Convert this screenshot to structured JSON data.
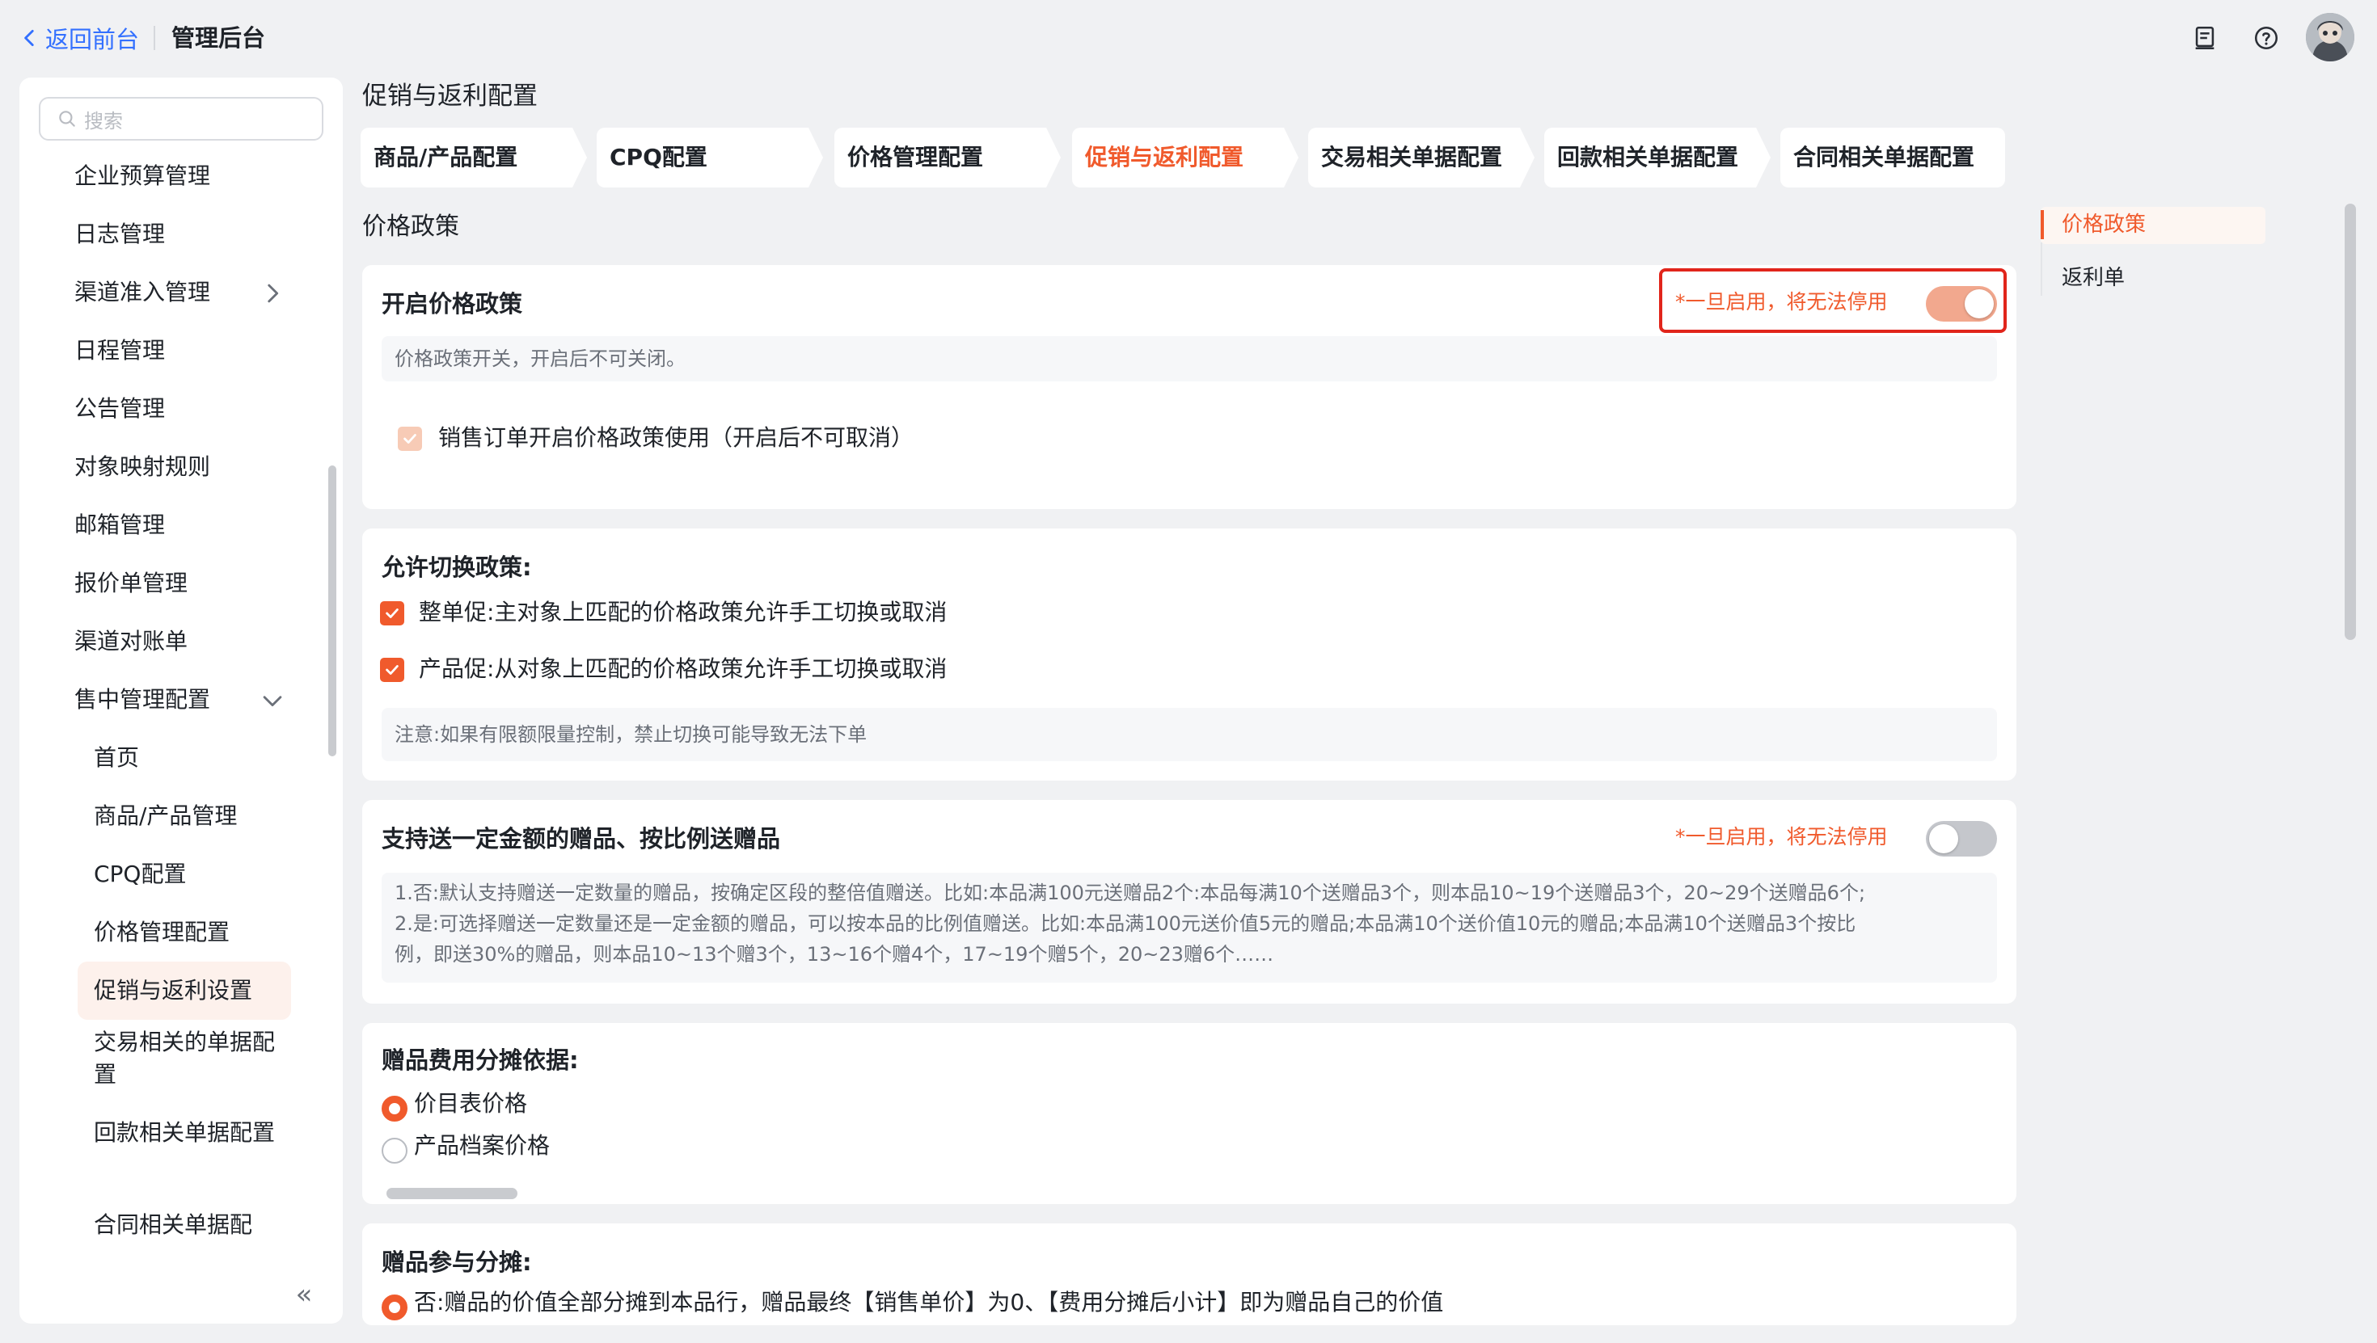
{
  "header": {
    "back_label": "返回前台",
    "app_title": "管理后台",
    "icons": [
      "document-icon",
      "help-icon",
      "avatar"
    ]
  },
  "sidebar": {
    "search_placeholder": "搜索",
    "items": [
      {
        "label": "企业预算管理"
      },
      {
        "label": "日志管理"
      },
      {
        "label": "渠道准入管理",
        "expandable": true,
        "expanded": false
      },
      {
        "label": "日程管理"
      },
      {
        "label": "公告管理"
      },
      {
        "label": "对象映射规则"
      },
      {
        "label": "邮箱管理"
      },
      {
        "label": "报价单管理"
      },
      {
        "label": "渠道对账单"
      },
      {
        "label": "售中管理配置",
        "expandable": true,
        "expanded": true
      }
    ],
    "sub_items": [
      {
        "label": "首页"
      },
      {
        "label": "商品/产品管理"
      },
      {
        "label": "CPQ配置"
      },
      {
        "label": "价格管理配置"
      },
      {
        "label": "促销与返利设置",
        "active": true
      },
      {
        "label": "交易相关的单据配置"
      },
      {
        "label": "回款相关单据配置"
      },
      {
        "label": "合同相关单据配"
      }
    ],
    "collapse_glyph": "«"
  },
  "main": {
    "page_title": "促销与返利配置",
    "tabs": [
      {
        "label": "商品/产品配置"
      },
      {
        "label": "CPQ配置"
      },
      {
        "label": "价格管理配置"
      },
      {
        "label": "促销与返利配置",
        "active": true
      },
      {
        "label": "交易相关单据配置"
      },
      {
        "label": "回款相关单据配置"
      },
      {
        "label": "合同相关单据配置"
      }
    ],
    "section_title": "价格政策",
    "card1": {
      "title": "开启价格政策",
      "warning": "*一旦启用，将无法停用",
      "toggle_on": true,
      "desc": "价格政策开关，开启后不可关闭。",
      "checkbox_label": "销售订单开启价格政策使用（开启后不可取消）",
      "checkbox_checked": true,
      "checkbox_disabled": true
    },
    "card2": {
      "title": "允许切换政策:",
      "options": [
        {
          "label": "整单促:主对象上匹配的价格政策允许手工切换或取消",
          "checked": true
        },
        {
          "label": "产品促:从对象上匹配的价格政策允许手工切换或取消",
          "checked": true
        }
      ],
      "note": "注意:如果有限额限量控制，禁止切换可能导致无法下单"
    },
    "card3": {
      "title": "支持送一定金额的赠品、按比例送赠品",
      "warning": "*一旦启用，将无法停用",
      "toggle_on": false,
      "desc_line1": "1.否:默认支持赠送一定数量的赠品，按确定区段的整倍值赠送。比如:本品满100元送赠品2个:本品每满10个送赠品3个，则本品10~19个送赠品3个，20~29个送赠品6个;",
      "desc_line2": "2.是:可选择赠送一定数量还是一定金额的赠品，可以按本品的比例值赠送。比如:本品满100元送价值5元的赠品;本品满10个送价值10元的赠品;本品满10个送赠品3个按比",
      "desc_line3": "例，即送30%的赠品，则本品10~13个赠3个，13~16个赠4个，17~19个赠5个，20~23赠6个……"
    },
    "card4": {
      "title": "赠品费用分摊依据:",
      "options": [
        {
          "label": "价目表价格",
          "selected": true
        },
        {
          "label": "产品档案价格",
          "selected": false
        }
      ]
    },
    "card5": {
      "title": "赠品参与分摊:",
      "options": [
        {
          "label": "否:赠品的价值全部分摊到本品行，赠品最终【销售单价】为0、【费用分摊后小计】即为赠品自己的价值",
          "selected": true
        }
      ]
    }
  },
  "anchor_nav": {
    "items": [
      {
        "label": "价格政策",
        "active": true
      },
      {
        "label": "返利单"
      }
    ]
  },
  "colors": {
    "accent": "#f05a2c",
    "link_blue": "#3370ff",
    "highlight_frame": "#e1251b",
    "page_bg": "#f0f1f3"
  }
}
